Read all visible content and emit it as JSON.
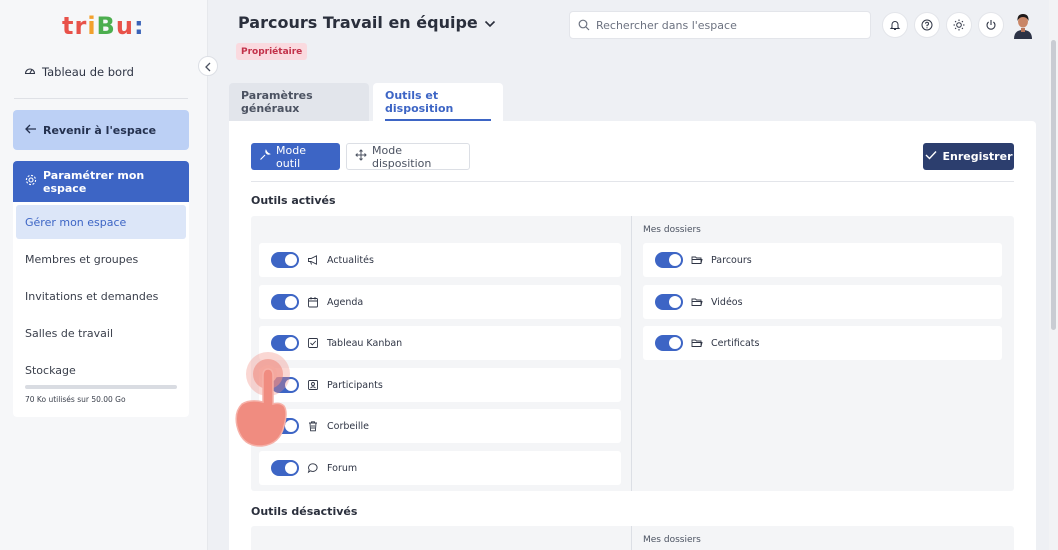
{
  "app": {
    "logo_parts": [
      "tr",
      "i",
      "B",
      "u",
      ":"
    ]
  },
  "sidebar": {
    "dashboard_label": "Tableau de bord",
    "back_label": "Revenir à l'espace",
    "settings_label": "Paramétrer mon espace",
    "items": [
      {
        "label": "Gérer mon espace",
        "active": true
      },
      {
        "label": "Membres et groupes"
      },
      {
        "label": "Invitations et demandes"
      },
      {
        "label": "Salles de travail"
      },
      {
        "label": "Stockage"
      }
    ],
    "storage": {
      "used_text": "70 Ko utilisés sur 50.00 Go",
      "fraction": 0.0
    }
  },
  "header": {
    "title": "Parcours Travail en équipe",
    "badge": "Propriétaire",
    "search_placeholder": "Rechercher dans l'espace",
    "icons": [
      "bell-icon",
      "help-icon",
      "sun-icon",
      "power-icon",
      "avatar"
    ]
  },
  "tabs": [
    {
      "label": "Paramètres généraux",
      "active": false
    },
    {
      "label": "Outils et disposition",
      "active": true
    }
  ],
  "toolbar": {
    "mode_outil": "Mode outil",
    "mode_disposition": "Mode disposition",
    "save": "Enregistrer"
  },
  "enabled_tools": {
    "title": "Outils activés",
    "left": [
      {
        "label": "Actualités",
        "icon": "megaphone-icon",
        "on": true
      },
      {
        "label": "Agenda",
        "icon": "calendar-icon",
        "on": true
      },
      {
        "label": "Tableau Kanban",
        "icon": "checkbox-icon",
        "on": true
      },
      {
        "label": "Participants",
        "icon": "contact-icon",
        "on": true
      },
      {
        "label": "Corbeille",
        "icon": "trash-icon",
        "on": true
      },
      {
        "label": "Forum",
        "icon": "chat-icon",
        "on": true
      }
    ],
    "folders_title": "Mes dossiers",
    "folders": [
      {
        "label": "Parcours",
        "icon": "folder-icon",
        "on": true
      },
      {
        "label": "Vidéos",
        "icon": "folder-icon",
        "on": true
      },
      {
        "label": "Certificats",
        "icon": "folder-icon",
        "on": true
      }
    ]
  },
  "disabled_tools": {
    "title": "Outils désactivés",
    "folders_title": "Mes dossiers"
  },
  "colors": {
    "primary": "#3d65c5",
    "dark": "#2c3e6e",
    "badge_bg": "#fadadf",
    "badge_text": "#c2324a"
  }
}
